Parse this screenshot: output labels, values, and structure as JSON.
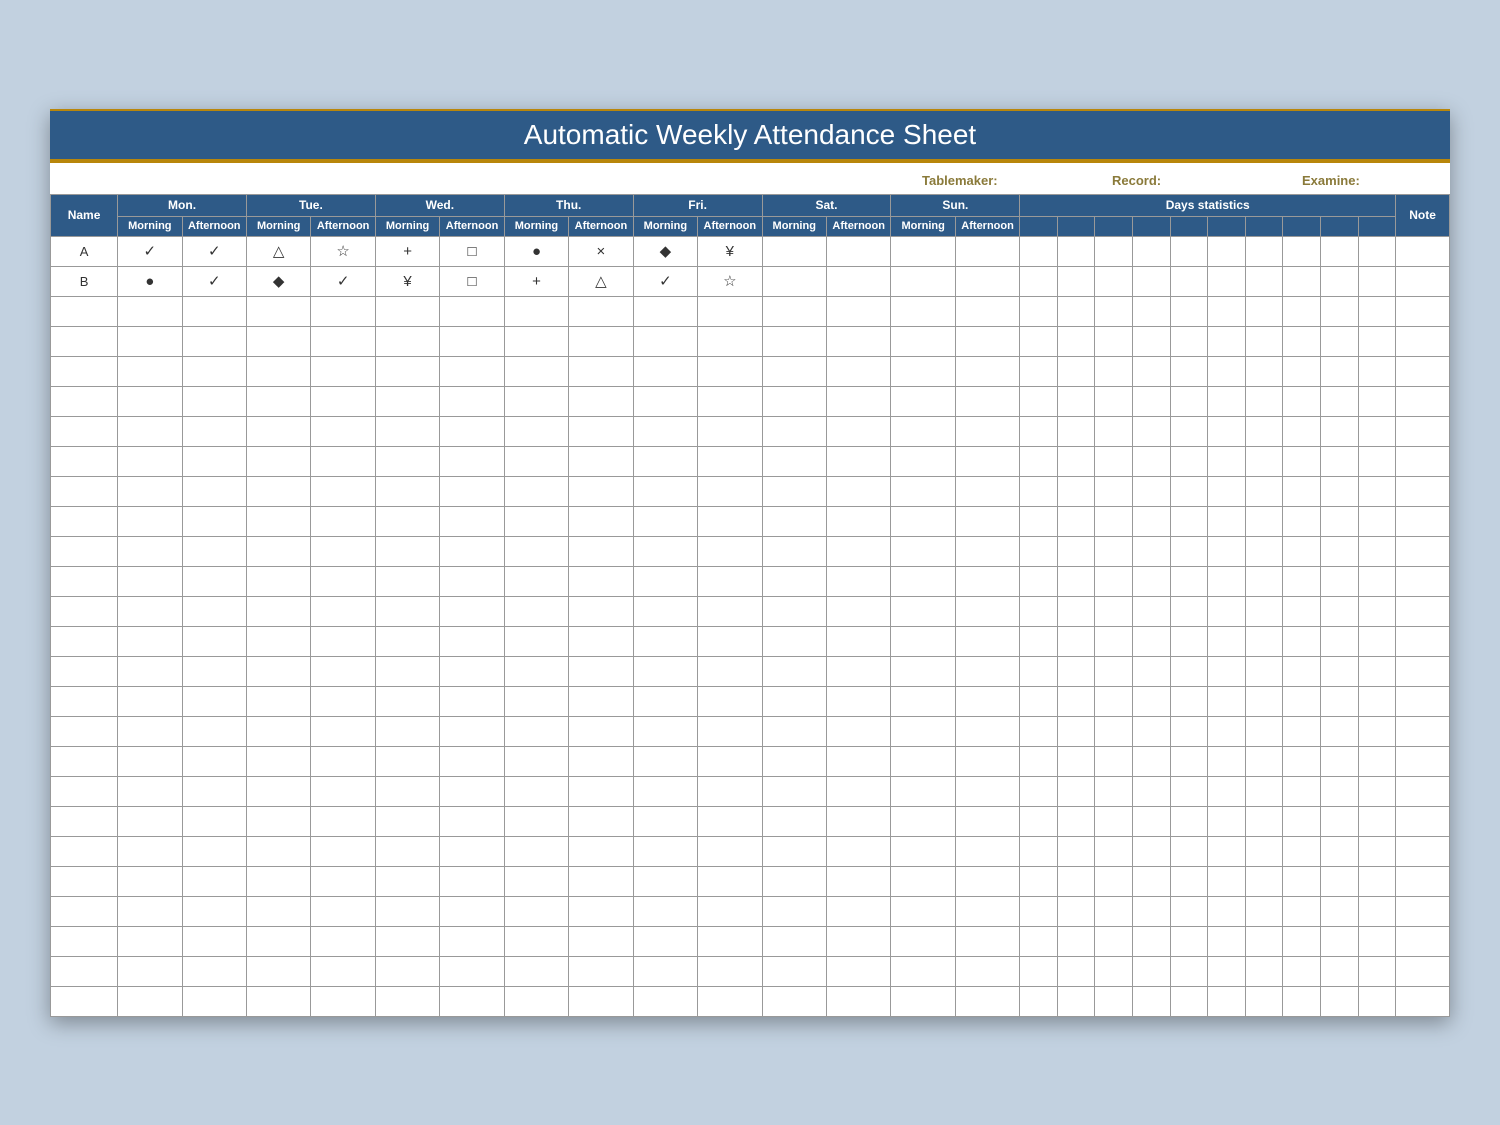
{
  "title": "Automatic Weekly Attendance Sheet",
  "meta": {
    "tablemaker": "Tablemaker:",
    "record": "Record:",
    "examine": "Examine:"
  },
  "headers": {
    "name": "Name",
    "days": [
      "Mon.",
      "Tue.",
      "Wed.",
      "Thu.",
      "Fri.",
      "Sat.",
      "Sun."
    ],
    "halves": [
      "Morning",
      "Afternoon"
    ],
    "stats": "Days statistics",
    "note": "Note"
  },
  "rows": [
    {
      "name": "A",
      "cells": [
        "✓",
        "✓",
        "△",
        "☆",
        "+",
        "□",
        "●",
        "×",
        "◆",
        "¥",
        "",
        "",
        "",
        ""
      ]
    },
    {
      "name": "B",
      "cells": [
        "●",
        "✓",
        "◆",
        "✓",
        "¥",
        "□",
        "+",
        "△",
        "✓",
        "☆",
        "",
        "",
        "",
        ""
      ]
    }
  ],
  "emptyRows": 24,
  "statCols": 10
}
